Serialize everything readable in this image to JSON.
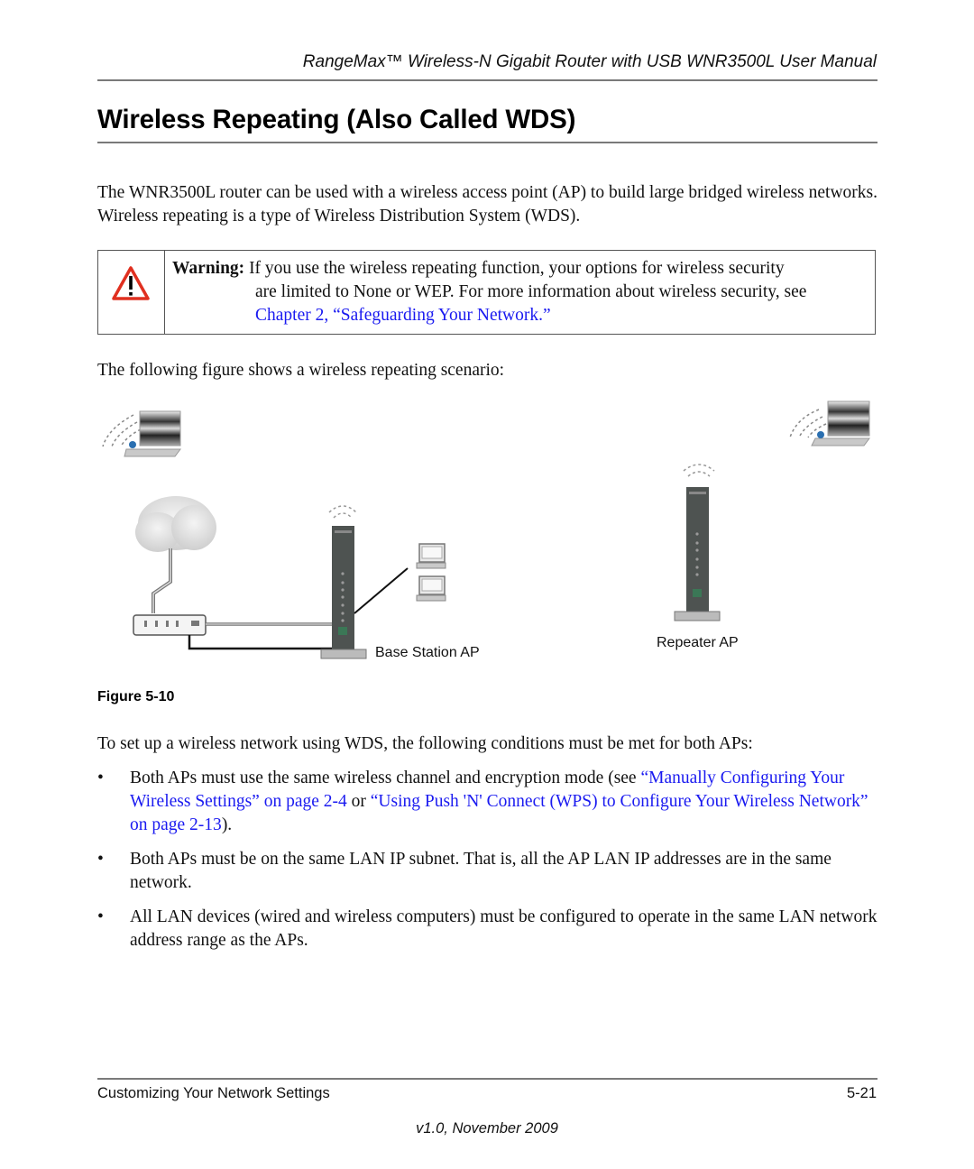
{
  "header": {
    "running_title": "RangeMax™ Wireless-N Gigabit Router with USB WNR3500L User Manual"
  },
  "section": {
    "title": "Wireless Repeating (Also Called WDS)"
  },
  "intro": {
    "text": "The WNR3500L router can be used with a wireless access point (AP) to build large bridged wireless networks. Wireless repeating is a type of Wireless Distribution System (WDS)."
  },
  "warning": {
    "icon": "warning-triangle-icon",
    "label": "Warning:",
    "line1": " If you use the wireless repeating function, your options for wireless security",
    "line2": "are limited to None or WEP. For more information about wireless security, see",
    "link": "Chapter 2, “Safeguarding Your Network.”",
    "icon_color": "#e03020",
    "link_color": "#1a1af0"
  },
  "figure_intro": {
    "text": "The following figure shows a wireless repeating scenario:"
  },
  "figure": {
    "caption": "Figure 5-10",
    "labels": {
      "base_station": "Base Station AP",
      "repeater": "Repeater AP"
    },
    "icons": [
      "laptop-icon",
      "cloud-icon",
      "modem-icon",
      "router-icon",
      "desktop-computer-icon",
      "wireless-signal-icon"
    ]
  },
  "conditions": {
    "intro": "To set up a wireless network using WDS, the following conditions must be met for both APs:",
    "bullets": [
      {
        "marker": "•",
        "pre": "Both APs must use the same wireless channel and encryption mode (see ",
        "link1": "“Manually Configuring Your Wireless Settings” on page 2-4",
        "mid": " or ",
        "link2": "“Using Push 'N' Connect (WPS) to Configure Your Wireless Network” on page 2-13",
        "post": ")."
      },
      {
        "marker": "•",
        "text": "Both APs must be on the same LAN IP subnet. That is, all the AP LAN IP addresses are in the same network."
      },
      {
        "marker": "•",
        "text": "All LAN devices (wired and wireless computers) must be configured to operate in the same LAN network address range as the APs."
      }
    ]
  },
  "footer": {
    "chapter": "Customizing Your Network Settings",
    "page": "5-21",
    "version": "v1.0, November 2009"
  }
}
